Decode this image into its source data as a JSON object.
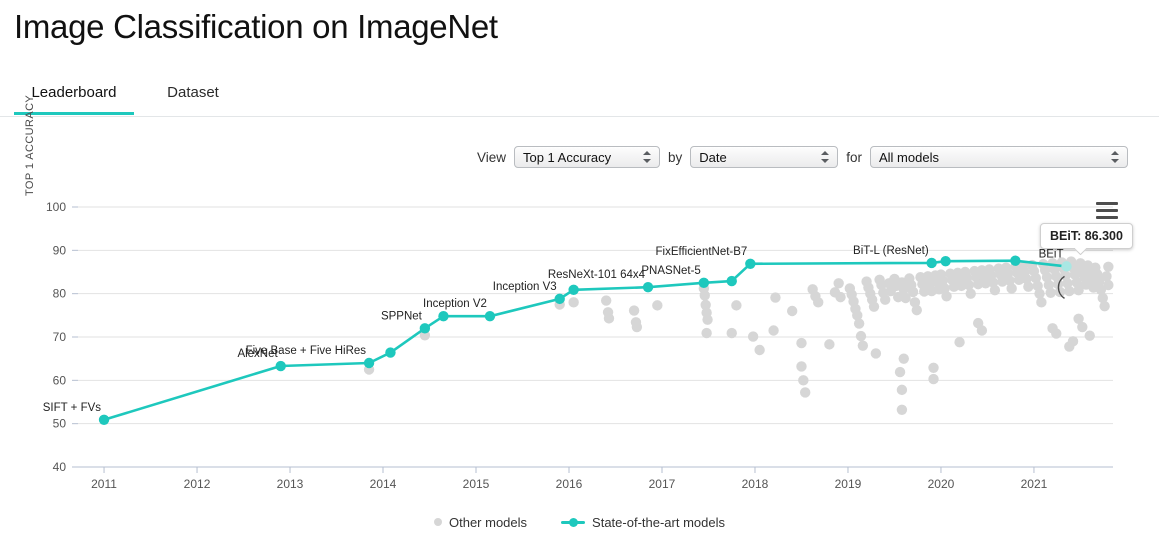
{
  "header": {
    "title": "Image Classification on ImageNet"
  },
  "tabs": [
    {
      "label": "Leaderboard",
      "active": true
    },
    {
      "label": "Dataset",
      "active": false
    }
  ],
  "controls": {
    "view_label": "View",
    "by_label": "by",
    "for_label": "for",
    "metric": "Top 1 Accuracy",
    "axis": "Date",
    "filter": "All models"
  },
  "chart_menu_icon": "hamburger-menu-icon",
  "tooltip": {
    "text": "BEiT: 86.300"
  },
  "legend": [
    {
      "label": "Other models",
      "color": "#d6d6d6",
      "marker": "dot"
    },
    {
      "label": "State-of-the-art models",
      "color": "#1ec8bd",
      "marker": "line-dot"
    }
  ],
  "colors": {
    "accent": "#1ec8bd",
    "other_models": "#d6d6d6",
    "grid": "#e2e2e2",
    "axis": "#b6bfd0"
  },
  "chart_data": {
    "type": "scatter",
    "title": "Image Classification on ImageNet",
    "xlabel": "",
    "ylabel": "TOP 1 ACCURACY",
    "xlim": [
      2010.72,
      2021.85
    ],
    "ylim": [
      40,
      100
    ],
    "xticks": [
      "2011",
      "2012",
      "2013",
      "2014",
      "2015",
      "2016",
      "2017",
      "2018",
      "2019",
      "2020",
      "2021"
    ],
    "yticks": [
      40,
      50,
      60,
      70,
      80,
      90,
      100
    ],
    "grid": true,
    "legend_position": "bottom-center",
    "series": [
      {
        "name": "State-of-the-art models",
        "color": "#1ec8bd",
        "type": "line",
        "points": [
          {
            "label": "SIFT + FVs",
            "x": 2011.0,
            "y": 50.9
          },
          {
            "label": "AlexNet",
            "x": 2012.9,
            "y": 63.3
          },
          {
            "label": "Five Base + Five HiRes",
            "x": 2013.85,
            "y": 64.0
          },
          {
            "label": "",
            "x": 2014.08,
            "y": 66.4
          },
          {
            "label": "SPPNet",
            "x": 2014.45,
            "y": 72.0
          },
          {
            "label": "",
            "x": 2014.65,
            "y": 74.8
          },
          {
            "label": "Inception V2",
            "x": 2015.15,
            "y": 74.8
          },
          {
            "label": "Inception V3",
            "x": 2015.9,
            "y": 78.8
          },
          {
            "label": "",
            "x": 2016.05,
            "y": 80.9
          },
          {
            "label": "ResNeXt-101 64x4",
            "x": 2016.85,
            "y": 81.5
          },
          {
            "label": "PNASNet-5",
            "x": 2017.45,
            "y": 82.5
          },
          {
            "label": "",
            "x": 2017.75,
            "y": 82.9
          },
          {
            "label": "FixEfficientNet-B7",
            "x": 2017.95,
            "y": 86.9
          },
          {
            "label": "BiT-L (ResNet)",
            "x": 2019.9,
            "y": 87.1
          },
          {
            "label": "",
            "x": 2020.05,
            "y": 87.5
          },
          {
            "label": "",
            "x": 2020.8,
            "y": 87.6
          },
          {
            "label": "BEiT",
            "x": 2021.35,
            "y": 86.3,
            "highlight": true
          }
        ]
      },
      {
        "name": "Other models",
        "color": "#d6d6d6",
        "type": "scatter",
        "points": [
          [
            2013.85,
            62.5
          ],
          [
            2014.45,
            70.4
          ],
          [
            2015.9,
            77.5
          ],
          [
            2016.05,
            78.0
          ],
          [
            2016.4,
            78.4
          ],
          [
            2016.42,
            75.7
          ],
          [
            2016.43,
            74.3
          ],
          [
            2016.7,
            76.1
          ],
          [
            2016.72,
            73.4
          ],
          [
            2016.73,
            72.3
          ],
          [
            2016.95,
            77.3
          ],
          [
            2017.45,
            81.2
          ],
          [
            2017.46,
            79.6
          ],
          [
            2017.47,
            77.4
          ],
          [
            2017.48,
            75.6
          ],
          [
            2017.49,
            74.0
          ],
          [
            2017.8,
            77.3
          ],
          [
            2017.48,
            70.9
          ],
          [
            2017.75,
            70.9
          ],
          [
            2018.22,
            79.1
          ],
          [
            2018.4,
            76.0
          ],
          [
            2018.62,
            81.0
          ],
          [
            2018.65,
            79.4
          ],
          [
            2018.68,
            78.0
          ],
          [
            2018.86,
            80.3
          ],
          [
            2018.9,
            82.4
          ],
          [
            2018.92,
            79.2
          ],
          [
            2019.02,
            81.2
          ],
          [
            2019.04,
            79.8
          ],
          [
            2019.06,
            78.2
          ],
          [
            2019.08,
            76.5
          ],
          [
            2019.1,
            75.0
          ],
          [
            2019.12,
            73.1
          ],
          [
            2019.14,
            70.2
          ],
          [
            2019.16,
            68.0
          ],
          [
            2019.2,
            82.8
          ],
          [
            2019.22,
            81.4
          ],
          [
            2019.24,
            80.0
          ],
          [
            2019.26,
            78.6
          ],
          [
            2019.28,
            77.0
          ],
          [
            2019.34,
            83.2
          ],
          [
            2019.36,
            82.0
          ],
          [
            2019.38,
            80.2
          ],
          [
            2019.4,
            78.6
          ],
          [
            2019.44,
            82.4
          ],
          [
            2019.46,
            80.6
          ],
          [
            2019.5,
            83.4
          ],
          [
            2019.52,
            81.8
          ],
          [
            2019.54,
            79.2
          ],
          [
            2019.58,
            82.6
          ],
          [
            2019.6,
            81.0
          ],
          [
            2019.62,
            79.0
          ],
          [
            2019.66,
            83.5
          ],
          [
            2019.68,
            82.0
          ],
          [
            2019.7,
            80.4
          ],
          [
            2019.72,
            78.0
          ],
          [
            2019.74,
            76.2
          ],
          [
            2019.78,
            83.8
          ],
          [
            2019.8,
            82.2
          ],
          [
            2019.82,
            80.5
          ],
          [
            2019.86,
            84.0
          ],
          [
            2019.88,
            82.4
          ],
          [
            2019.9,
            80.6
          ],
          [
            2019.92,
            62.9
          ],
          [
            2019.92,
            60.3
          ],
          [
            2019.94,
            84.2
          ],
          [
            2019.96,
            82.6
          ],
          [
            2019.98,
            81.0
          ],
          [
            2020.0,
            84.4
          ],
          [
            2020.02,
            83.0
          ],
          [
            2020.04,
            81.2
          ],
          [
            2020.06,
            79.4
          ],
          [
            2020.1,
            84.6
          ],
          [
            2020.12,
            83.2
          ],
          [
            2020.14,
            81.6
          ],
          [
            2020.18,
            84.8
          ],
          [
            2020.2,
            83.4
          ],
          [
            2020.22,
            81.8
          ],
          [
            2020.26,
            85.0
          ],
          [
            2020.28,
            83.6
          ],
          [
            2020.3,
            82.0
          ],
          [
            2020.32,
            80.0
          ],
          [
            2020.36,
            85.2
          ],
          [
            2020.38,
            83.8
          ],
          [
            2020.4,
            82.2
          ],
          [
            2020.44,
            85.4
          ],
          [
            2020.46,
            84.0
          ],
          [
            2020.48,
            82.4
          ],
          [
            2020.52,
            85.6
          ],
          [
            2020.54,
            84.2
          ],
          [
            2020.56,
            82.6
          ],
          [
            2020.58,
            80.8
          ],
          [
            2020.62,
            85.8
          ],
          [
            2020.64,
            84.4
          ],
          [
            2020.66,
            82.8
          ],
          [
            2020.7,
            86.0
          ],
          [
            2020.72,
            84.6
          ],
          [
            2020.74,
            83.0
          ],
          [
            2020.76,
            81.2
          ],
          [
            2020.8,
            86.2
          ],
          [
            2020.82,
            84.8
          ],
          [
            2020.84,
            83.2
          ],
          [
            2020.88,
            86.4
          ],
          [
            2020.9,
            85.0
          ],
          [
            2020.92,
            83.4
          ],
          [
            2020.94,
            81.6
          ],
          [
            2020.98,
            86.6
          ],
          [
            2021.0,
            85.2
          ],
          [
            2021.02,
            83.6
          ],
          [
            2021.04,
            81.8
          ],
          [
            2021.06,
            80.0
          ],
          [
            2021.08,
            78.0
          ],
          [
            2021.1,
            86.8
          ],
          [
            2021.12,
            85.4
          ],
          [
            2021.14,
            83.8
          ],
          [
            2021.16,
            82.0
          ],
          [
            2021.18,
            80.2
          ],
          [
            2021.2,
            87.0
          ],
          [
            2021.22,
            85.6
          ],
          [
            2021.24,
            84.0
          ],
          [
            2021.26,
            82.2
          ],
          [
            2021.28,
            80.4
          ],
          [
            2021.3,
            87.2
          ],
          [
            2021.32,
            85.8
          ],
          [
            2021.34,
            84.2
          ],
          [
            2021.36,
            82.4
          ],
          [
            2021.38,
            80.6
          ],
          [
            2021.4,
            87.4
          ],
          [
            2021.42,
            86.0
          ],
          [
            2021.44,
            84.4
          ],
          [
            2021.46,
            82.6
          ],
          [
            2021.48,
            80.8
          ],
          [
            2021.5,
            87.0
          ],
          [
            2021.52,
            85.5
          ],
          [
            2021.54,
            83.9
          ],
          [
            2021.56,
            82.1
          ],
          [
            2021.58,
            86.5
          ],
          [
            2021.6,
            85.0
          ],
          [
            2021.62,
            83.3
          ],
          [
            2021.64,
            81.4
          ],
          [
            2021.66,
            86.0
          ],
          [
            2021.68,
            84.5
          ],
          [
            2021.7,
            82.8
          ],
          [
            2021.72,
            80.9
          ],
          [
            2021.74,
            79.0
          ],
          [
            2021.76,
            77.1
          ],
          [
            2021.48,
            74.2
          ],
          [
            2021.52,
            72.3
          ],
          [
            2021.6,
            70.3
          ],
          [
            2021.38,
            67.8
          ],
          [
            2021.42,
            69.0
          ],
          [
            2021.2,
            72.0
          ],
          [
            2021.24,
            70.8
          ],
          [
            2020.4,
            73.2
          ],
          [
            2020.44,
            71.5
          ],
          [
            2020.2,
            68.8
          ],
          [
            2019.3,
            66.2
          ],
          [
            2018.8,
            68.3
          ],
          [
            2018.2,
            71.5
          ],
          [
            2019.6,
            65.0
          ],
          [
            2019.56,
            61.9
          ],
          [
            2019.58,
            57.8
          ],
          [
            2019.58,
            53.2
          ],
          [
            2018.5,
            63.2
          ],
          [
            2018.52,
            60.0
          ],
          [
            2018.54,
            57.2
          ],
          [
            2018.5,
            68.6
          ],
          [
            2017.98,
            70.1
          ],
          [
            2018.05,
            67.0
          ],
          [
            2021.78,
            84.0
          ],
          [
            2021.8,
            86.2
          ],
          [
            2021.8,
            82.0
          ]
        ]
      }
    ]
  }
}
